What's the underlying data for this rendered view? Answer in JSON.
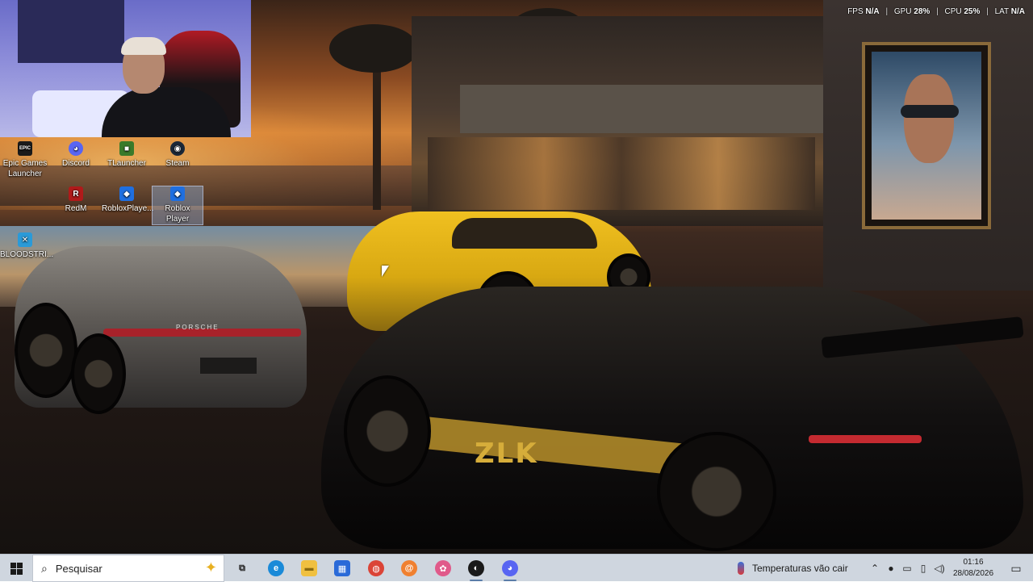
{
  "overlay": {
    "fps_label": "FPS",
    "fps_value": "N/A",
    "gpu_label": "GPU",
    "gpu_value": "28%",
    "cpu_label": "CPU",
    "cpu_value": "25%",
    "lat_label": "LAT",
    "lat_value": "N/A",
    "separator": "|"
  },
  "wallpaper": {
    "plate_text": "ZLK",
    "gray_car_badge": "PORSCHE"
  },
  "desktop_icons": [
    {
      "label": "Epic Games Launcher",
      "icon": "epic-games-icon",
      "color": "#1a1a1a",
      "glyph": "EPIC"
    },
    {
      "label": "Discord",
      "icon": "discord-icon",
      "color": "#5865f2",
      "glyph": "◕"
    },
    {
      "label": "TLauncher",
      "icon": "tlauncher-icon",
      "color": "#3a7a2a",
      "glyph": "■"
    },
    {
      "label": "Steam",
      "icon": "steam-icon",
      "color": "#1b2838",
      "glyph": "◉"
    },
    {
      "label": "RedM",
      "icon": "redm-icon",
      "color": "#b01a1a",
      "glyph": "R"
    },
    {
      "label": "RobloxPlaye...",
      "icon": "roblox-icon",
      "color": "#1f6fe0",
      "glyph": "◆"
    },
    {
      "label": "Roblox Player",
      "icon": "roblox-icon",
      "color": "#1f6fe0",
      "glyph": "◆"
    },
    {
      "label": "BLOODSTRI...",
      "icon": "bloodstrike-icon",
      "color": "#2a9ad8",
      "glyph": "✕"
    }
  ],
  "taskbar": {
    "search_placeholder": "Pesquisar",
    "apps": [
      {
        "name": "task-view",
        "icon": "task-view-icon",
        "glyph": "⧉",
        "color": "#444444",
        "text_color": "#222222"
      },
      {
        "name": "edge",
        "icon": "edge-icon",
        "glyph": "e",
        "color": "#1a8ad8",
        "text_color": "#ffffff"
      },
      {
        "name": "file-explorer",
        "icon": "folder-icon",
        "glyph": "▬",
        "color": "#f0c040",
        "text_color": "#8a6a10"
      },
      {
        "name": "microsoft-store",
        "icon": "store-icon",
        "glyph": "▦",
        "color": "#2a6ad8",
        "text_color": "#ffffff"
      },
      {
        "name": "chrome",
        "icon": "chrome-icon",
        "glyph": "◍",
        "color": "#db4437",
        "text_color": "#ffffff"
      },
      {
        "name": "app-swirl",
        "icon": "swirl-app-icon",
        "glyph": "@",
        "color": "#f08030",
        "text_color": "#ffffff"
      },
      {
        "name": "app-flower",
        "icon": "flower-app-icon",
        "glyph": "✿",
        "color": "#e05a8a",
        "text_color": "#ffffff"
      },
      {
        "name": "app-obs",
        "icon": "obs-icon",
        "glyph": "◐",
        "color": "#1a1a1a",
        "text_color": "#ffffff"
      },
      {
        "name": "discord",
        "icon": "discord-icon",
        "glyph": "◕",
        "color": "#5865f2",
        "text_color": "#ffffff"
      }
    ],
    "weather_text": "Temperaturas vão cair",
    "tray_icons": [
      "chevron-up-icon",
      "microphone-icon",
      "network-icon",
      "battery-icon",
      "volume-icon"
    ],
    "time": "01:16",
    "date": "28/08/2026"
  }
}
